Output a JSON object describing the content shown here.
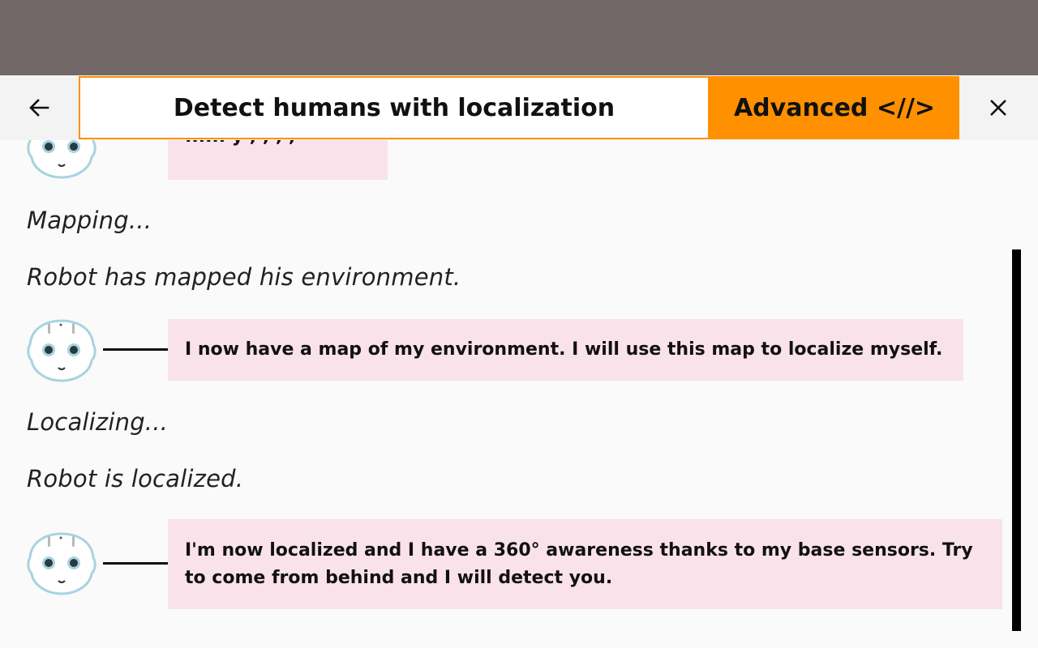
{
  "header": {
    "back_icon": "arrow-left-icon",
    "title": "Detect humans with localization",
    "advanced_label": "Advanced <//>",
    "close_icon": "close-icon"
  },
  "colors": {
    "status_bar": "#716867",
    "accent": "#ff9000",
    "bubble": "#fae2ea",
    "robot_outline": "#a7d3e0"
  },
  "conversation": {
    "partial_bubble_text": "...... y ,  ,  ,  ,",
    "status_mapping": "Mapping...",
    "status_mapped": "Robot has mapped his environment.",
    "message_map": "I now have a map of my environment. I will use this map to localize myself.",
    "status_localizing": "Localizing...",
    "status_localized": "Robot is localized.",
    "message_localized": "I'm now localized and I have a 360° awareness thanks to my base sensors. Try to come from behind and I will detect you."
  }
}
